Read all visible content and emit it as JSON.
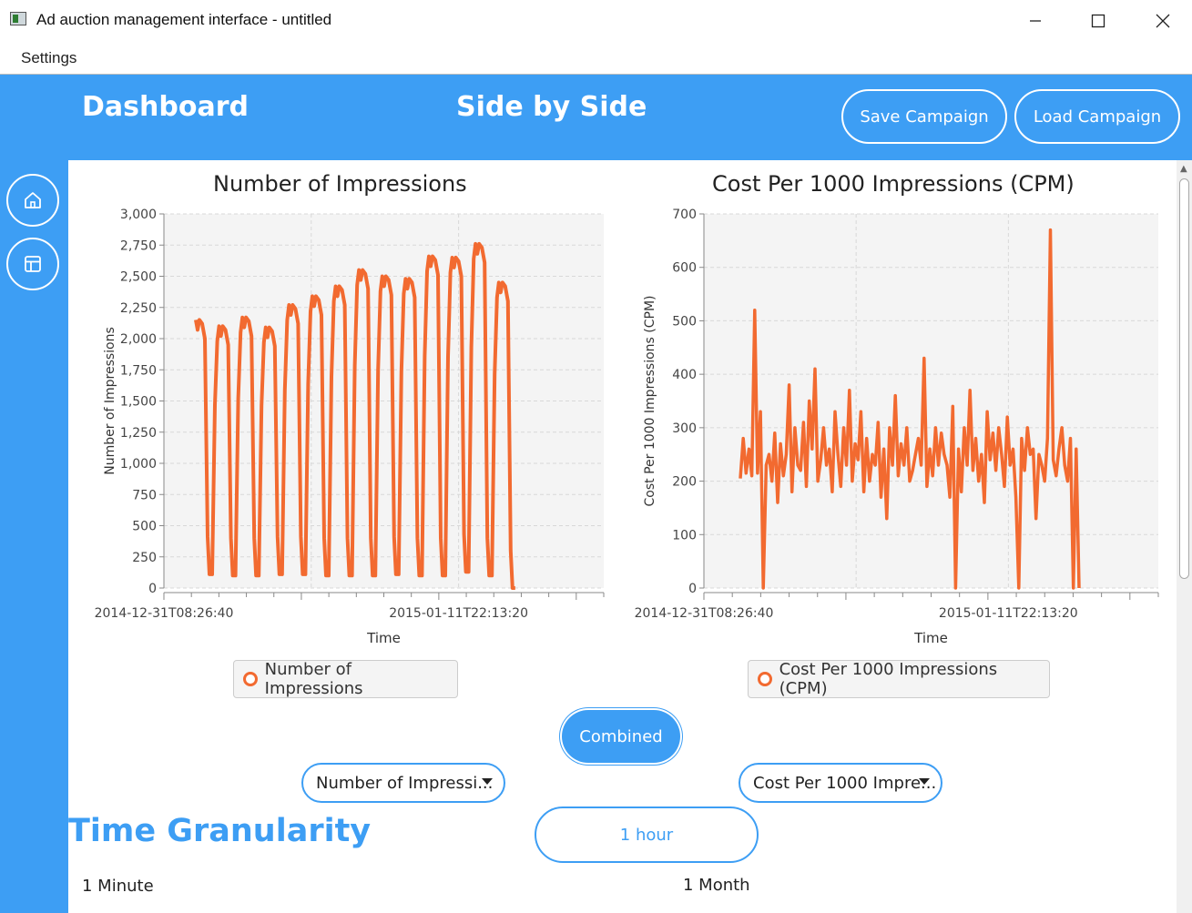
{
  "window": {
    "title": "Ad auction management interface - untitled"
  },
  "menu": {
    "settings": "Settings"
  },
  "header": {
    "dashboard": "Dashboard",
    "view_title": "Side by Side",
    "save_label": "Save Campaign",
    "load_label": "Load Campaign"
  },
  "colors": {
    "accent": "#3d9ef4",
    "series": "#f26a30",
    "plot_bg": "#f4f4f4"
  },
  "icons": {
    "home": "home-icon",
    "layout": "layout-icon"
  },
  "chart_data": [
    {
      "type": "line",
      "title": "Number of Impressions",
      "xlabel": "Time",
      "ylabel": "Number of Impressions",
      "x_ticks": [
        "2014-12-31T08:26:40",
        "2015-01-11T22:13:20"
      ],
      "ylim": [
        0,
        3000
      ],
      "y_ticks": [
        "0",
        "250",
        "500",
        "750",
        "1,000",
        "1,250",
        "1,500",
        "1,750",
        "2,000",
        "2,250",
        "2,500",
        "2,750",
        "3,000"
      ],
      "grid": true,
      "legend": "Number of Impressions",
      "series": [
        {
          "name": "Number of Impressions",
          "description": "daily cycle of hourly impressions",
          "daily_peaks": [
            2150,
            2100,
            2170,
            2090,
            2270,
            2340,
            2420,
            2550,
            2500,
            2480,
            2660,
            2650,
            2760,
            2450
          ],
          "daily_troughs": [
            110,
            100,
            100,
            110,
            110,
            100,
            100,
            100,
            110,
            100,
            100,
            130,
            100,
            0
          ]
        }
      ]
    },
    {
      "type": "line",
      "title": "Cost Per 1000 Impressions (CPM)",
      "xlabel": "Time",
      "ylabel": "Cost Per 1000 Impressions (CPM)",
      "x_ticks": [
        "2014-12-31T08:26:40",
        "2015-01-11T22:13:20"
      ],
      "ylim": [
        0,
        700
      ],
      "y_ticks": [
        "0",
        "100",
        "200",
        "300",
        "400",
        "500",
        "600",
        "700"
      ],
      "grid": true,
      "legend": "Cost Per 1000 Impressions (CPM)",
      "series": [
        {
          "name": "Cost Per 1000 Impressions (CPM)",
          "values": [
            205,
            280,
            215,
            260,
            210,
            520,
            215,
            330,
            0,
            230,
            250,
            200,
            290,
            160,
            270,
            210,
            250,
            380,
            180,
            300,
            230,
            220,
            310,
            190,
            350,
            260,
            410,
            200,
            240,
            300,
            230,
            260,
            180,
            330,
            250,
            190,
            300,
            230,
            370,
            200,
            270,
            240,
            330,
            180,
            280,
            200,
            250,
            230,
            310,
            170,
            260,
            130,
            300,
            230,
            360,
            210,
            270,
            230,
            300,
            200,
            220,
            250,
            280,
            230,
            430,
            190,
            260,
            210,
            300,
            230,
            290,
            250,
            230,
            170,
            340,
            0,
            260,
            180,
            300,
            230,
            370,
            220,
            280,
            200,
            250,
            160,
            330,
            240,
            290,
            220,
            300,
            250,
            190,
            320,
            230,
            260,
            170,
            0,
            280,
            220,
            300,
            250,
            260,
            130,
            250,
            230,
            200,
            280,
            670,
            240,
            210,
            260,
            300,
            230,
            200,
            280,
            0,
            260,
            0
          ]
        }
      ]
    }
  ],
  "legends": {
    "left": "Number of Impressions",
    "right": "Cost Per 1000 Impressions (CPM)"
  },
  "controls": {
    "combined_label": "Combined",
    "left_select": "Number of Impressi...",
    "right_select": "Cost Per 1000 Impre..."
  },
  "granularity": {
    "title": "Time Granularity",
    "current": "1 hour",
    "min_label": "1 Minute",
    "max_label": "1 Month"
  }
}
